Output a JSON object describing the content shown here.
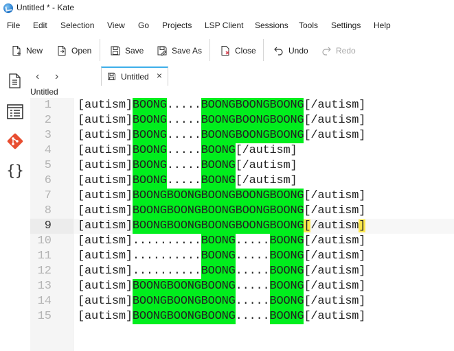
{
  "window": {
    "title": "Untitled * - Kate"
  },
  "menu": [
    "File",
    "Edit",
    "Selection",
    "View",
    "Go",
    "Projects",
    "LSP Client",
    "Sessions",
    "Tools",
    "Settings",
    "Help"
  ],
  "toolbar": {
    "new": "New",
    "open": "Open",
    "save": "Save",
    "save_as": "Save As",
    "close": "Close",
    "undo": "Undo",
    "redo": "Redo"
  },
  "tabs": {
    "active_label": "Untitled",
    "doc_label": "Untitled"
  },
  "colors": {
    "highlight": "#00ee1d",
    "bracket_match": "#fde84e",
    "tab_accent": "#3daee9"
  },
  "editor": {
    "current_line": 9,
    "lines": [
      [
        [
          "[autism]",
          false
        ],
        [
          "BOONG",
          true
        ],
        [
          ".....",
          false
        ],
        [
          "BOONGBOONGBOONG",
          true
        ],
        [
          "[/autism]",
          false
        ]
      ],
      [
        [
          "[autism]",
          false
        ],
        [
          "BOONG",
          true
        ],
        [
          ".....",
          false
        ],
        [
          "BOONGBOONGBOONG",
          true
        ],
        [
          "[/autism]",
          false
        ]
      ],
      [
        [
          "[autism]",
          false
        ],
        [
          "BOONG",
          true
        ],
        [
          ".....",
          false
        ],
        [
          "BOONGBOONGBOONG",
          true
        ],
        [
          "[/autism]",
          false
        ]
      ],
      [
        [
          "[autism]",
          false
        ],
        [
          "BOONG",
          true
        ],
        [
          ".....",
          false
        ],
        [
          "BOONG",
          true
        ],
        [
          "[/autism]",
          false
        ]
      ],
      [
        [
          "[autism]",
          false
        ],
        [
          "BOONG",
          true
        ],
        [
          ".....",
          false
        ],
        [
          "BOONG",
          true
        ],
        [
          "[/autism]",
          false
        ]
      ],
      [
        [
          "[autism]",
          false
        ],
        [
          "BOONG",
          true
        ],
        [
          ".....",
          false
        ],
        [
          "BOONG",
          true
        ],
        [
          "[/autism]",
          false
        ]
      ],
      [
        [
          "[autism]",
          false
        ],
        [
          "BOONGBOONGBOONGBOONGBOONG",
          true
        ],
        [
          "[/autism]",
          false
        ]
      ],
      [
        [
          "[autism]",
          false
        ],
        [
          "BOONGBOONGBOONGBOONGBOONG",
          true
        ],
        [
          "[/autism]",
          false
        ]
      ],
      [
        [
          "[autism]",
          false
        ],
        [
          "BOONGBOONGBOONGBOONGBOONG",
          true
        ],
        [
          "[/autism]",
          false
        ]
      ],
      [
        [
          "[autism]",
          false
        ],
        [
          "..........",
          false
        ],
        [
          "BOONG",
          true
        ],
        [
          ".....",
          false
        ],
        [
          "BOONG",
          true
        ],
        [
          "[/autism]",
          false
        ]
      ],
      [
        [
          "[autism]",
          false
        ],
        [
          "..........",
          false
        ],
        [
          "BOONG",
          true
        ],
        [
          ".....",
          false
        ],
        [
          "BOONG",
          true
        ],
        [
          "[/autism]",
          false
        ]
      ],
      [
        [
          "[autism]",
          false
        ],
        [
          "..........",
          false
        ],
        [
          "BOONG",
          true
        ],
        [
          ".....",
          false
        ],
        [
          "BOONG",
          true
        ],
        [
          "[/autism]",
          false
        ]
      ],
      [
        [
          "[autism]",
          false
        ],
        [
          "BOONGBOONGBOONG",
          true
        ],
        [
          ".....",
          false
        ],
        [
          "BOONG",
          true
        ],
        [
          "[/autism]",
          false
        ]
      ],
      [
        [
          "[autism]",
          false
        ],
        [
          "BOONGBOONGBOONG",
          true
        ],
        [
          ".....",
          false
        ],
        [
          "BOONG",
          true
        ],
        [
          "[/autism]",
          false
        ]
      ],
      [
        [
          "[autism]",
          false
        ],
        [
          "BOONGBOONGBOONG",
          true
        ],
        [
          ".....",
          false
        ],
        [
          "BOONG",
          true
        ],
        [
          "[/autism]",
          false
        ]
      ]
    ]
  }
}
